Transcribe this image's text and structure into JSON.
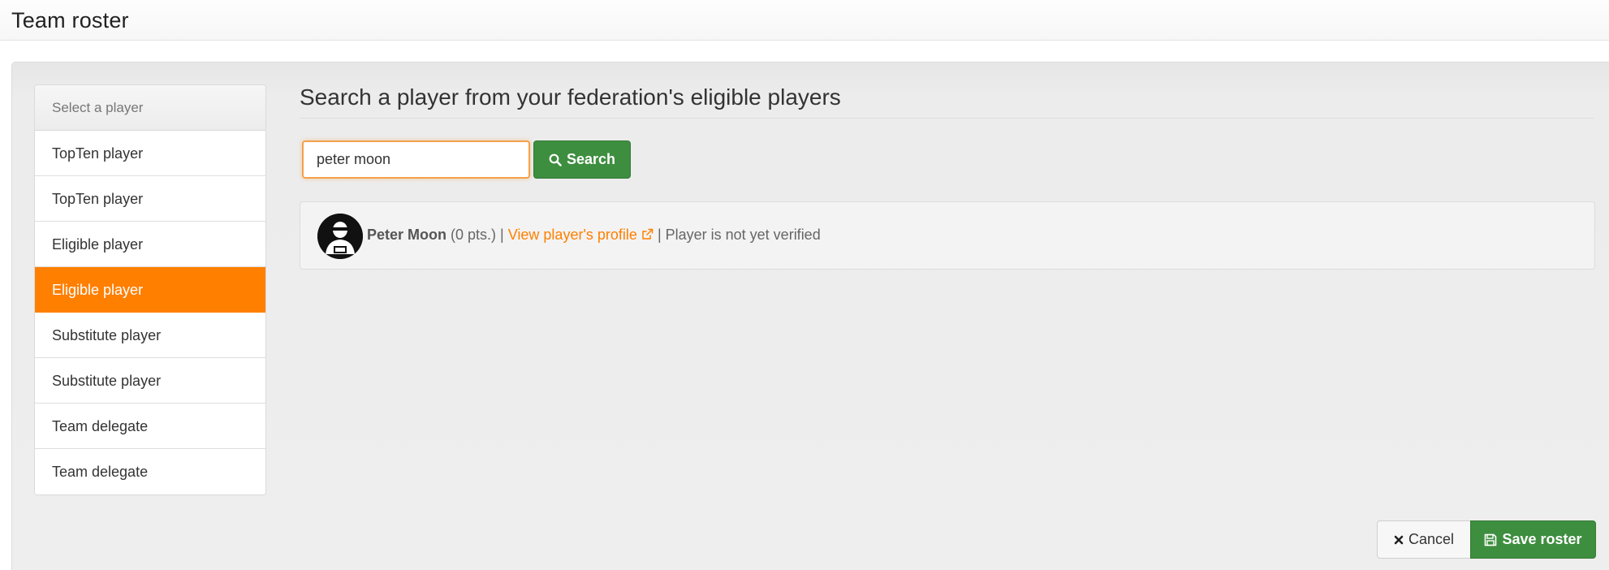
{
  "header": {
    "title": "Team roster"
  },
  "sidebar": {
    "header": "Select a player",
    "items": [
      {
        "label": "TopTen player"
      },
      {
        "label": "TopTen player"
      },
      {
        "label": "Eligible player"
      },
      {
        "label": "Eligible player",
        "active": true
      },
      {
        "label": "Substitute player"
      },
      {
        "label": "Substitute player"
      },
      {
        "label": "Team delegate"
      },
      {
        "label": "Team delegate"
      }
    ]
  },
  "search": {
    "heading": "Search a player from your federation's eligible players",
    "value": "peter moon",
    "button_label": "Search",
    "button_icon": "search-icon"
  },
  "result": {
    "name": "Peter Moon",
    "points": "(0 pts.)",
    "separator_1": " | ",
    "profile_link": "View player's profile",
    "separator_2": " | ",
    "status": "Player is not yet verified"
  },
  "actions": {
    "cancel_label": "Cancel",
    "save_label": "Save roster"
  },
  "colors": {
    "accent_orange": "#ff7f00",
    "primary_green": "#3e8e3f"
  }
}
